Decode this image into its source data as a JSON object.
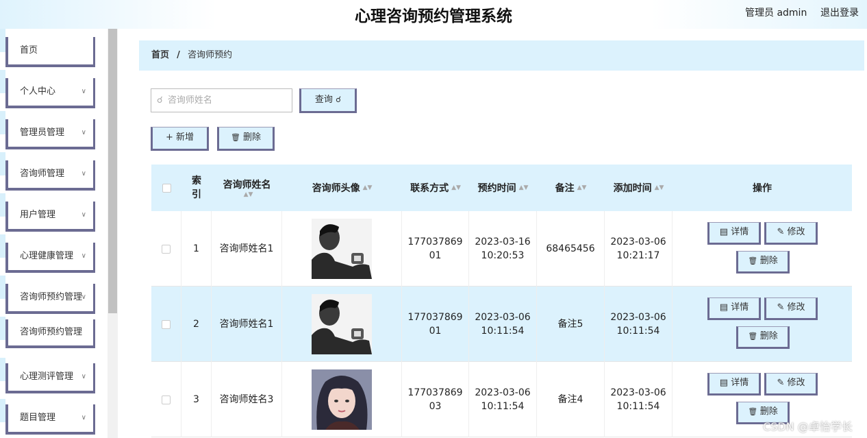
{
  "header": {
    "title": "心理咨询预约管理系统",
    "user_label": "管理员 admin",
    "logout_label": "退出登录"
  },
  "sidebar": {
    "items": [
      {
        "label": "首页"
      },
      {
        "label": "个人中心"
      },
      {
        "label": "管理员管理"
      },
      {
        "label": "咨询师管理"
      },
      {
        "label": "用户管理"
      },
      {
        "label": "心理健康管理"
      },
      {
        "label": "咨询师预约管理"
      },
      {
        "label": "咨询师预约管理"
      },
      {
        "label": "心理测评管理"
      },
      {
        "label": "题目管理"
      }
    ]
  },
  "breadcrumb": {
    "home": "首页",
    "separator": "/",
    "current": "咨询师预约"
  },
  "search": {
    "placeholder": "咨询师姓名",
    "query_label": "查询"
  },
  "toolbar": {
    "add_label": "新增",
    "delete_label": "删除"
  },
  "table": {
    "headers": {
      "index_line1": "索",
      "index_line2": "引",
      "name": "咨询师姓名",
      "avatar": "咨询师头像",
      "contact": "联系方式",
      "booking_time": "预约时间",
      "remark": "备注",
      "added_time": "添加时间",
      "actions": "操作"
    },
    "rows": [
      {
        "index": "1",
        "name": "咨询师姓名1",
        "contact_1": "177037869",
        "contact_2": "01",
        "booking_date": "2023-03-16",
        "booking_clock": "10:20:53",
        "remark": "68465456",
        "added_date": "2023-03-06",
        "added_clock": "10:21:17",
        "avatar": "man-portrait"
      },
      {
        "index": "2",
        "name": "咨询师姓名1",
        "contact_1": "177037869",
        "contact_2": "01",
        "booking_date": "2023-03-06",
        "booking_clock": "10:11:54",
        "remark": "备注5",
        "added_date": "2023-03-06",
        "added_clock": "10:11:54",
        "avatar": "man-portrait"
      },
      {
        "index": "3",
        "name": "咨询师姓名3",
        "contact_1": "177037869",
        "contact_2": "03",
        "booking_date": "2023-03-06",
        "booking_clock": "10:11:54",
        "remark": "备注4",
        "added_date": "2023-03-06",
        "added_clock": "10:11:54",
        "avatar": "woman-portrait"
      }
    ],
    "actions": {
      "detail": "详情",
      "edit": "修改",
      "delete": "删除"
    }
  },
  "watermark": "CSDN @卓怡学长",
  "colors": {
    "accent": "#dcf2fd",
    "border": "#6b6b92"
  }
}
